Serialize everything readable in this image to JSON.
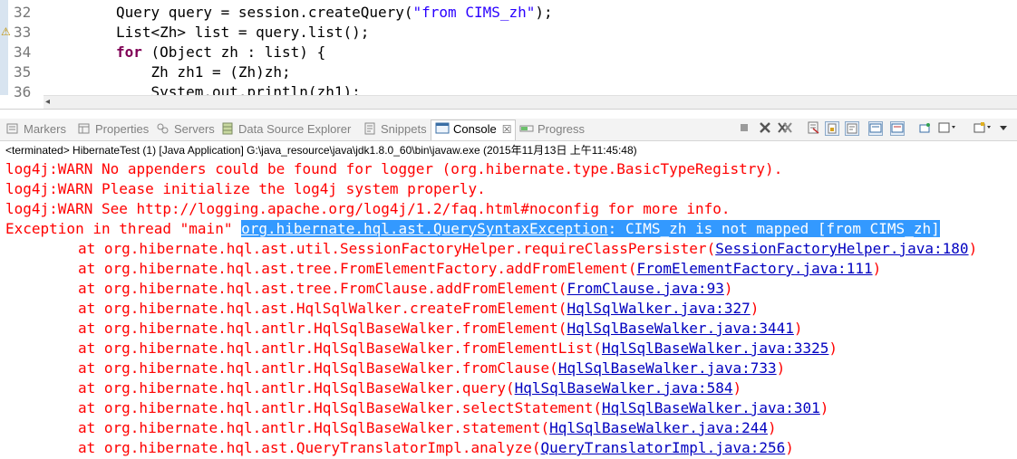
{
  "editor": {
    "lines": [
      {
        "no": "32",
        "parts": [
          {
            "t": "Query query = session.createQuery(",
            "c": ""
          },
          {
            "t": "\"from CIMS_zh\"",
            "c": "str"
          },
          {
            "t": ");",
            "c": ""
          }
        ]
      },
      {
        "no": "33",
        "parts": [
          {
            "t": "List<Zh> list = query.list();",
            "c": ""
          }
        ],
        "warning": true
      },
      {
        "no": "34",
        "parts": [
          {
            "t": "for",
            "c": "kw"
          },
          {
            "t": " (Object zh : list) {",
            "c": ""
          }
        ]
      },
      {
        "no": "35",
        "parts": [
          {
            "t": "    Zh zh1 = (Zh)zh;",
            "c": ""
          }
        ]
      },
      {
        "no": "36",
        "parts": [
          {
            "t": "    System.out.println(zh1);",
            "c": ""
          }
        ]
      }
    ]
  },
  "tabs": [
    {
      "id": "markers",
      "label": "Markers",
      "icon": "markers-icon"
    },
    {
      "id": "properties",
      "label": "Properties",
      "icon": "properties-icon"
    },
    {
      "id": "servers",
      "label": "Servers",
      "icon": "servers-icon"
    },
    {
      "id": "data-source-explorer",
      "label": "Data Source Explorer",
      "icon": "database-icon"
    },
    {
      "id": "snippets",
      "label": "Snippets",
      "icon": "snippets-icon"
    },
    {
      "id": "console",
      "label": "Console",
      "icon": "console-icon",
      "active": true,
      "close": "☒"
    },
    {
      "id": "progress",
      "label": "Progress",
      "icon": "progress-icon"
    }
  ],
  "toolbar_icons": [
    "terminate-icon",
    "remove-launch-icon",
    "remove-all-terminated-icon",
    "clear-console-icon",
    "scroll-lock-icon",
    "word-wrap-icon",
    "show-console-on-output-icon",
    "show-console-on-error-icon",
    "pin-console-icon",
    "display-selected-console-icon",
    "open-console-icon",
    "view-menu-icon"
  ],
  "console": {
    "header": "<terminated> HibernateTest (1) [Java Application] G:\\java_resource\\java\\jdk1.8.0_60\\bin\\javaw.exe (2015年11月13日 上午11:45:48)",
    "warn_lines": [
      "log4j:WARN No appenders could be found for logger (org.hibernate.type.BasicTypeRegistry).",
      "log4j:WARN Please initialize the log4j system properly.",
      "log4j:WARN See http://logging.apache.org/log4j/1.2/faq.html#noconfig for more info."
    ],
    "exception": {
      "prefix": "Exception in thread \"main\" ",
      "class": "org.hibernate.hql.ast.QuerySyntaxException",
      "message": ": CIMS_zh is not mapped [from CIMS_zh]"
    },
    "trace": [
      {
        "method": "at org.hibernate.hql.ast.util.SessionFactoryHelper.requireClassPersister(",
        "link": "SessionFactoryHelper.java:180"
      },
      {
        "method": "at org.hibernate.hql.ast.tree.FromElementFactory.addFromElement(",
        "link": "FromElementFactory.java:111"
      },
      {
        "method": "at org.hibernate.hql.ast.tree.FromClause.addFromElement(",
        "link": "FromClause.java:93"
      },
      {
        "method": "at org.hibernate.hql.ast.HqlSqlWalker.createFromElement(",
        "link": "HqlSqlWalker.java:327"
      },
      {
        "method": "at org.hibernate.hql.antlr.HqlSqlBaseWalker.fromElement(",
        "link": "HqlSqlBaseWalker.java:3441"
      },
      {
        "method": "at org.hibernate.hql.antlr.HqlSqlBaseWalker.fromElementList(",
        "link": "HqlSqlBaseWalker.java:3325"
      },
      {
        "method": "at org.hibernate.hql.antlr.HqlSqlBaseWalker.fromClause(",
        "link": "HqlSqlBaseWalker.java:733"
      },
      {
        "method": "at org.hibernate.hql.antlr.HqlSqlBaseWalker.query(",
        "link": "HqlSqlBaseWalker.java:584"
      },
      {
        "method": "at org.hibernate.hql.antlr.HqlSqlBaseWalker.selectStatement(",
        "link": "HqlSqlBaseWalker.java:301"
      },
      {
        "method": "at org.hibernate.hql.antlr.HqlSqlBaseWalker.statement(",
        "link": "HqlSqlBaseWalker.java:244"
      },
      {
        "method": "at org.hibernate.hql.ast.QueryTranslatorImpl.analyze(",
        "link": "QueryTranslatorImpl.java:256"
      }
    ],
    "close_paren": ")"
  },
  "colors": {
    "error": "#ff0000",
    "link": "#0000c0",
    "selection": "#3399ff",
    "keyword": "#7f0055",
    "string": "#2a00ff"
  }
}
